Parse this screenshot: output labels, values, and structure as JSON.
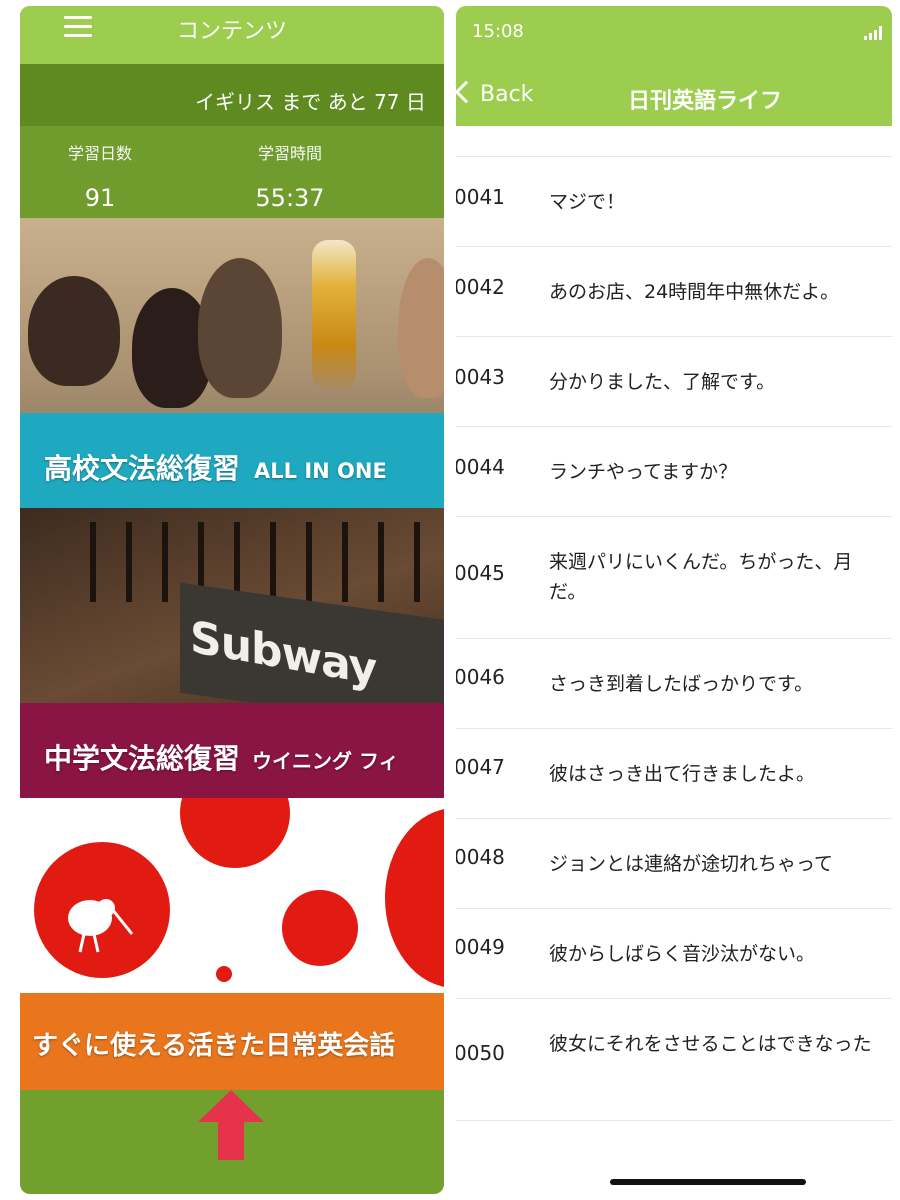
{
  "left": {
    "header_title": "コンテンツ",
    "marquee": "イギリス まで あと 77 日",
    "stats": [
      {
        "label": "学習日数",
        "value": "91"
      },
      {
        "label": "学習時間",
        "value": "55:37"
      }
    ],
    "courses": [
      {
        "title": "高校文法総復習",
        "subtitle": "ALL IN ONE"
      },
      {
        "title": "中学文法総復習",
        "subtitle": "ウイニング フィ",
        "image_text": "Subway"
      },
      {
        "title": "すぐに使える活きた日常英会話"
      }
    ]
  },
  "right": {
    "status_time": "15:08",
    "back_label": "Back",
    "title": "日刊英語ライフ",
    "items": [
      {
        "num": "0041",
        "text": "マジで！"
      },
      {
        "num": "0042",
        "text": "あのお店、24時間年中無休だよ。"
      },
      {
        "num": "0043",
        "text": "分かりました、了解です。"
      },
      {
        "num": "0044",
        "text": "ランチやってますか？"
      },
      {
        "num": "0045",
        "text": "来週パリにいくんだ。ちがった、月だ。"
      },
      {
        "num": "0046",
        "text": "さっき到着したばっかりです。"
      },
      {
        "num": "0047",
        "text": "彼はさっき出て行きましたよ。"
      },
      {
        "num": "0048",
        "text": "ジョンとは連絡が途切れちゃって"
      },
      {
        "num": "0049",
        "text": "彼からしばらく音沙汰がない。"
      },
      {
        "num": "0050",
        "text": "彼女にそれをさせることはできなった"
      }
    ]
  },
  "colors": {
    "header_green": "#9ccd4f",
    "dark_green": "#5f8a1f",
    "teal_band": "#1fa9c0",
    "magenta_band": "#8a1443",
    "orange_band": "#e9761d",
    "accent_red": "#e21b12"
  }
}
